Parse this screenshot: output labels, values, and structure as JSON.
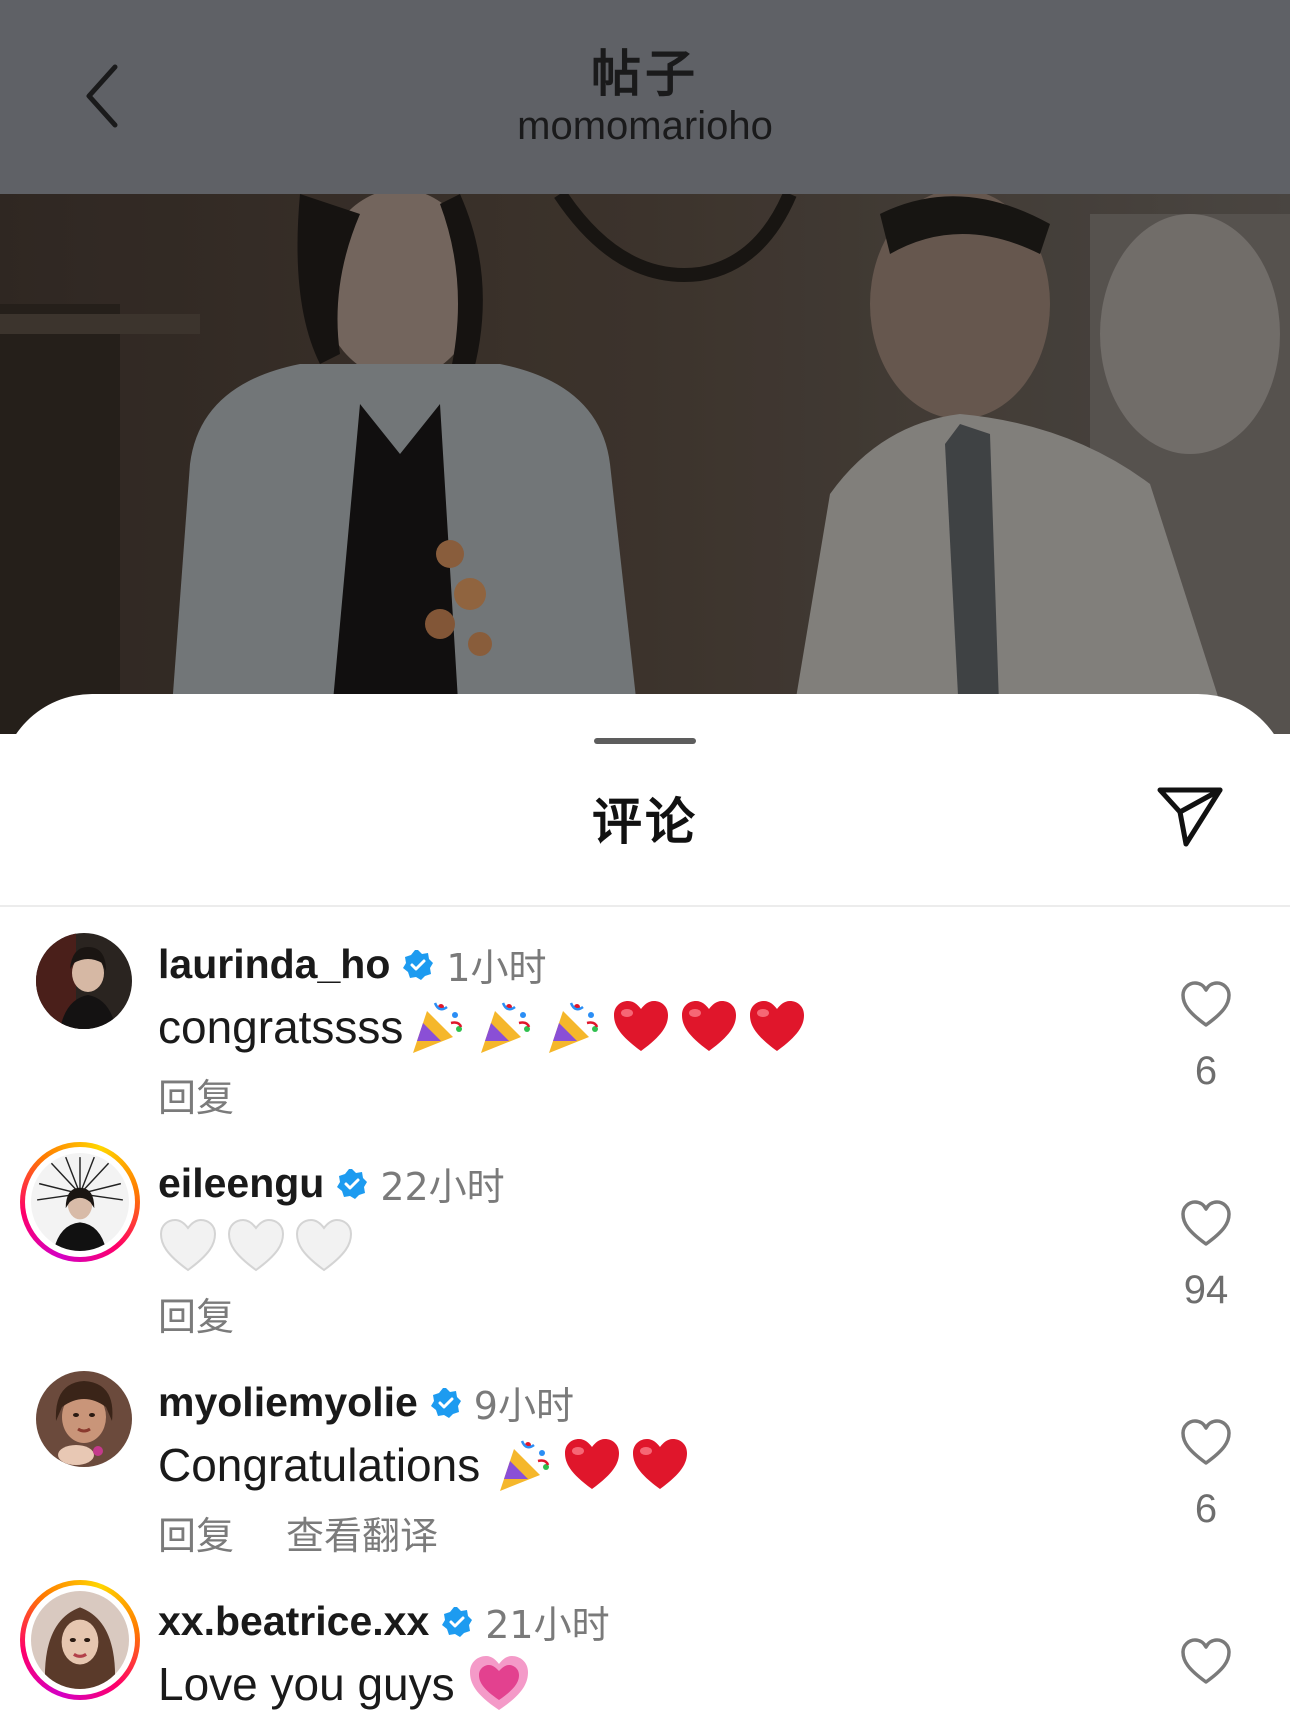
{
  "header": {
    "title": "帖子",
    "subtitle": "momomarioho",
    "back_icon": "chevron-left-icon"
  },
  "post": {
    "image": "dimmed-post-photo"
  },
  "comments_sheet": {
    "title": "评论",
    "share_icon": "paper-plane-icon",
    "reply_label": "回复",
    "translate_label": "查看翻译",
    "items": [
      {
        "username": "laurinda_ho",
        "verified": true,
        "time": "1小时",
        "text": "congratssss",
        "emojis": [
          "party-popper",
          "party-popper",
          "party-popper",
          "red-heart",
          "red-heart",
          "red-heart"
        ],
        "likes": "6",
        "story_ring": false,
        "show_translate": false
      },
      {
        "username": "eileengu",
        "verified": true,
        "time": "22小时",
        "text": "",
        "emojis": [
          "white-heart",
          "white-heart",
          "white-heart"
        ],
        "likes": "94",
        "story_ring": true,
        "show_translate": false
      },
      {
        "username": "myoliemyolie",
        "verified": true,
        "time": "9小时",
        "text": "Congratulations",
        "emojis": [
          "party-popper",
          "red-heart",
          "red-heart"
        ],
        "likes": "6",
        "story_ring": false,
        "show_translate": true
      },
      {
        "username": "xx.beatrice.xx",
        "verified": true,
        "time": "21小时",
        "text": "Love you guys",
        "emojis": [
          "growing-heart"
        ],
        "likes": "",
        "story_ring": true,
        "show_translate": false
      }
    ]
  },
  "colors": {
    "header_bg": "#5f6166",
    "verified_blue": "#1d9bf0",
    "heart_red": "#e0162b",
    "muted_text": "#7a7a7a"
  }
}
